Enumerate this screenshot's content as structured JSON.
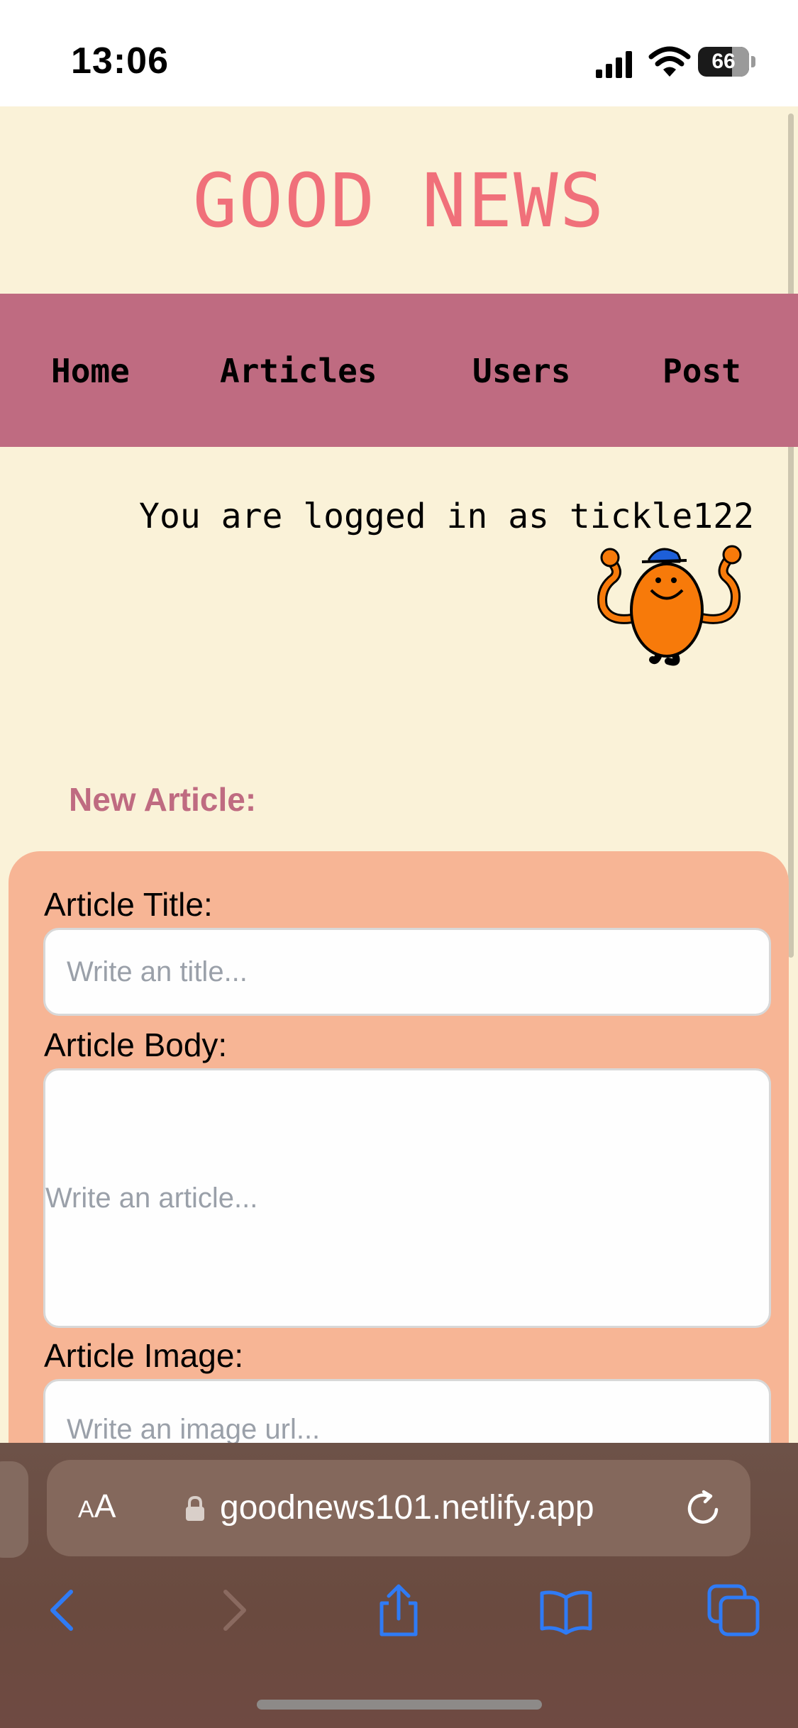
{
  "status_bar": {
    "time": "13:06",
    "battery": "66",
    "icons": [
      "signal-icon",
      "wifi-icon",
      "battery-icon"
    ]
  },
  "site": {
    "title": "GOOD NEWS",
    "title_color": "#f0707a"
  },
  "nav": {
    "background": "#bf6b81",
    "items": [
      {
        "label": "Home"
      },
      {
        "label": "Articles"
      },
      {
        "label": "Users"
      },
      {
        "label": "Post"
      }
    ]
  },
  "user": {
    "logged_in_text": "You are logged in as tickle122",
    "avatar_icon": "orange-character-avatar"
  },
  "form": {
    "heading": "New Article:",
    "card_color": "#f7b595",
    "title_label": "Article Title:",
    "title_placeholder": "Write an title...",
    "body_label": "Article Body:",
    "body_placeholder": "Write an article...",
    "image_label": "Article Image:",
    "image_placeholder": "Write an image url..."
  },
  "browser": {
    "aa_label_small": "A",
    "aa_label_big": "A",
    "url": "goodnews101.netlify.app",
    "icons": [
      "back-icon",
      "forward-icon",
      "share-icon",
      "bookmarks-icon",
      "tabs-icon",
      "lock-icon",
      "reload-icon"
    ],
    "accent": "#2f7bf5"
  }
}
